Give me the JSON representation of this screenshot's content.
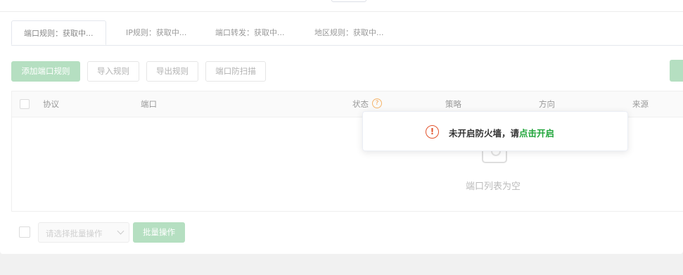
{
  "tabs": [
    {
      "label": "端口规则：获取中..."
    },
    {
      "label": "IP规则：获取中..."
    },
    {
      "label": "端口转发：获取中..."
    },
    {
      "label": "地区规则：获取中..."
    }
  ],
  "toolbar": {
    "add_label": "添加端口规则",
    "import_label": "导入规则",
    "export_label": "导出规则",
    "antiscan_label": "端口防扫描"
  },
  "table": {
    "columns": [
      "协议",
      "端口",
      "状态",
      "策略",
      "方向",
      "来源"
    ],
    "status_help_glyph": "?",
    "empty_text": "端口列表为空"
  },
  "footer": {
    "batch_placeholder": "请选择批量操作",
    "batch_button": "批量操作"
  },
  "toast": {
    "icon_glyph": "!",
    "message": "未开启防火墙，请",
    "link": "点击开启"
  },
  "colors": {
    "accent": "#20a53a",
    "accent_disabled": "#b5dfc1",
    "warning": "#e2532c"
  }
}
